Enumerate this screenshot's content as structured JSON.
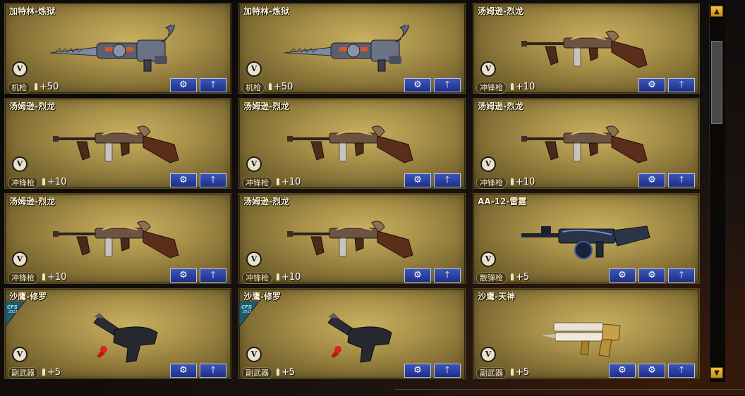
{
  "cards": [
    {
      "title": "加特林-炼狱",
      "category": "机枪",
      "bonus": "+50",
      "buttons": [
        "gear",
        "up"
      ],
      "weapon": "gatling",
      "ribbon": false
    },
    {
      "title": "加特林-炼狱",
      "category": "机枪",
      "bonus": "+50",
      "buttons": [
        "gear",
        "up"
      ],
      "weapon": "gatling",
      "ribbon": false
    },
    {
      "title": "汤姆逊-烈龙",
      "category": "冲锋枪",
      "bonus": "+10",
      "buttons": [
        "gear",
        "up"
      ],
      "weapon": "thompson",
      "ribbon": false
    },
    {
      "title": "汤姆逊-烈龙",
      "category": "冲锋枪",
      "bonus": "+10",
      "buttons": [
        "gear",
        "up"
      ],
      "weapon": "thompson",
      "ribbon": false
    },
    {
      "title": "汤姆逊-烈龙",
      "category": "冲锋枪",
      "bonus": "+10",
      "buttons": [
        "gear",
        "up"
      ],
      "weapon": "thompson",
      "ribbon": false
    },
    {
      "title": "汤姆逊-烈龙",
      "category": "冲锋枪",
      "bonus": "+10",
      "buttons": [
        "gear",
        "up"
      ],
      "weapon": "thompson",
      "ribbon": false
    },
    {
      "title": "汤姆逊-烈龙",
      "category": "冲锋枪",
      "bonus": "+10",
      "buttons": [
        "gear",
        "up"
      ],
      "weapon": "thompson",
      "ribbon": false
    },
    {
      "title": "汤姆逊-烈龙",
      "category": "冲锋枪",
      "bonus": "+10",
      "buttons": [
        "gear",
        "up"
      ],
      "weapon": "thompson",
      "ribbon": false
    },
    {
      "title": "AA-12-雷霆",
      "category": "散弹枪",
      "bonus": "+5",
      "buttons": [
        "gear",
        "gear2",
        "up"
      ],
      "weapon": "shotgun",
      "ribbon": false
    },
    {
      "title": "沙鹰-修罗",
      "category": "副武器",
      "bonus": "+5",
      "buttons": [
        "gear",
        "up"
      ],
      "weapon": "deagle",
      "ribbon": true
    },
    {
      "title": "沙鹰-修罗",
      "category": "副武器",
      "bonus": "+5",
      "buttons": [
        "gear",
        "up"
      ],
      "weapon": "deagle",
      "ribbon": true
    },
    {
      "title": "沙鹰-天神",
      "category": "副武器",
      "bonus": "+5",
      "buttons": [
        "gear",
        "gear2",
        "up"
      ],
      "weapon": "deagle-gold",
      "ribbon": false
    }
  ],
  "badge_letter": "V",
  "ribbon_text": "CFS 2017",
  "colors": {
    "card": "#a89049",
    "button": "#2a3f9e",
    "accent": "#f3c23b"
  }
}
